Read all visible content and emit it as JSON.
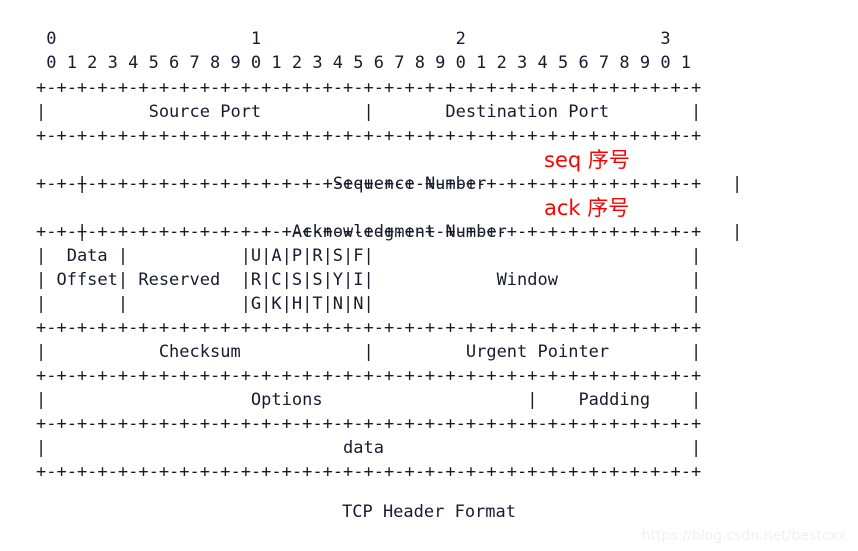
{
  "diagram": {
    "title": "TCP Header Format",
    "bit_ruler": {
      "decades": " 0                   1                   2                   3",
      "digits": " 0 1 2 3 4 5 6 7 8 9 0 1 2 3 4 5 6 7 8 9 0 1 2 3 4 5 6 7 8 9 0 1"
    },
    "separator": "+-+-+-+-+-+-+-+-+-+-+-+-+-+-+-+-+-+-+-+-+-+-+-+-+-+-+-+-+-+-+-+-+",
    "rows": [
      "|          Source Port          |       Destination Port        |",
      "|                        Sequence Number                        |",
      "|                    Acknowledgment Number                      |",
      "|  Data |           |U|A|P|R|S|F|                               |",
      "| Offset| Reserved  |R|C|S|S|Y|I|            Window             |",
      "|       |           |G|K|H|T|N|N|                               |",
      "|           Checksum            |         Urgent Pointer        |",
      "|                    Options                    |    Padding    |",
      "|                             data                              |"
    ],
    "annotations": {
      "seq": "seq 序号",
      "ack": "ack 序号"
    },
    "fields": [
      "Source Port",
      "Destination Port",
      "Sequence Number",
      "Acknowledgment Number",
      "Data Offset",
      "Reserved",
      "Window",
      "Checksum",
      "Urgent Pointer",
      "Options",
      "Padding",
      "data"
    ],
    "flags": [
      "URG",
      "ACK",
      "PSH",
      "RST",
      "SYN",
      "FIN"
    ],
    "colors": {
      "text": "#1a1a2e",
      "annotation": "#ff0000",
      "watermark": "#f0f0f0",
      "background": "#ffffff"
    }
  },
  "watermark": {
    "text": "https://blog.csdn.net/bestcxx"
  }
}
